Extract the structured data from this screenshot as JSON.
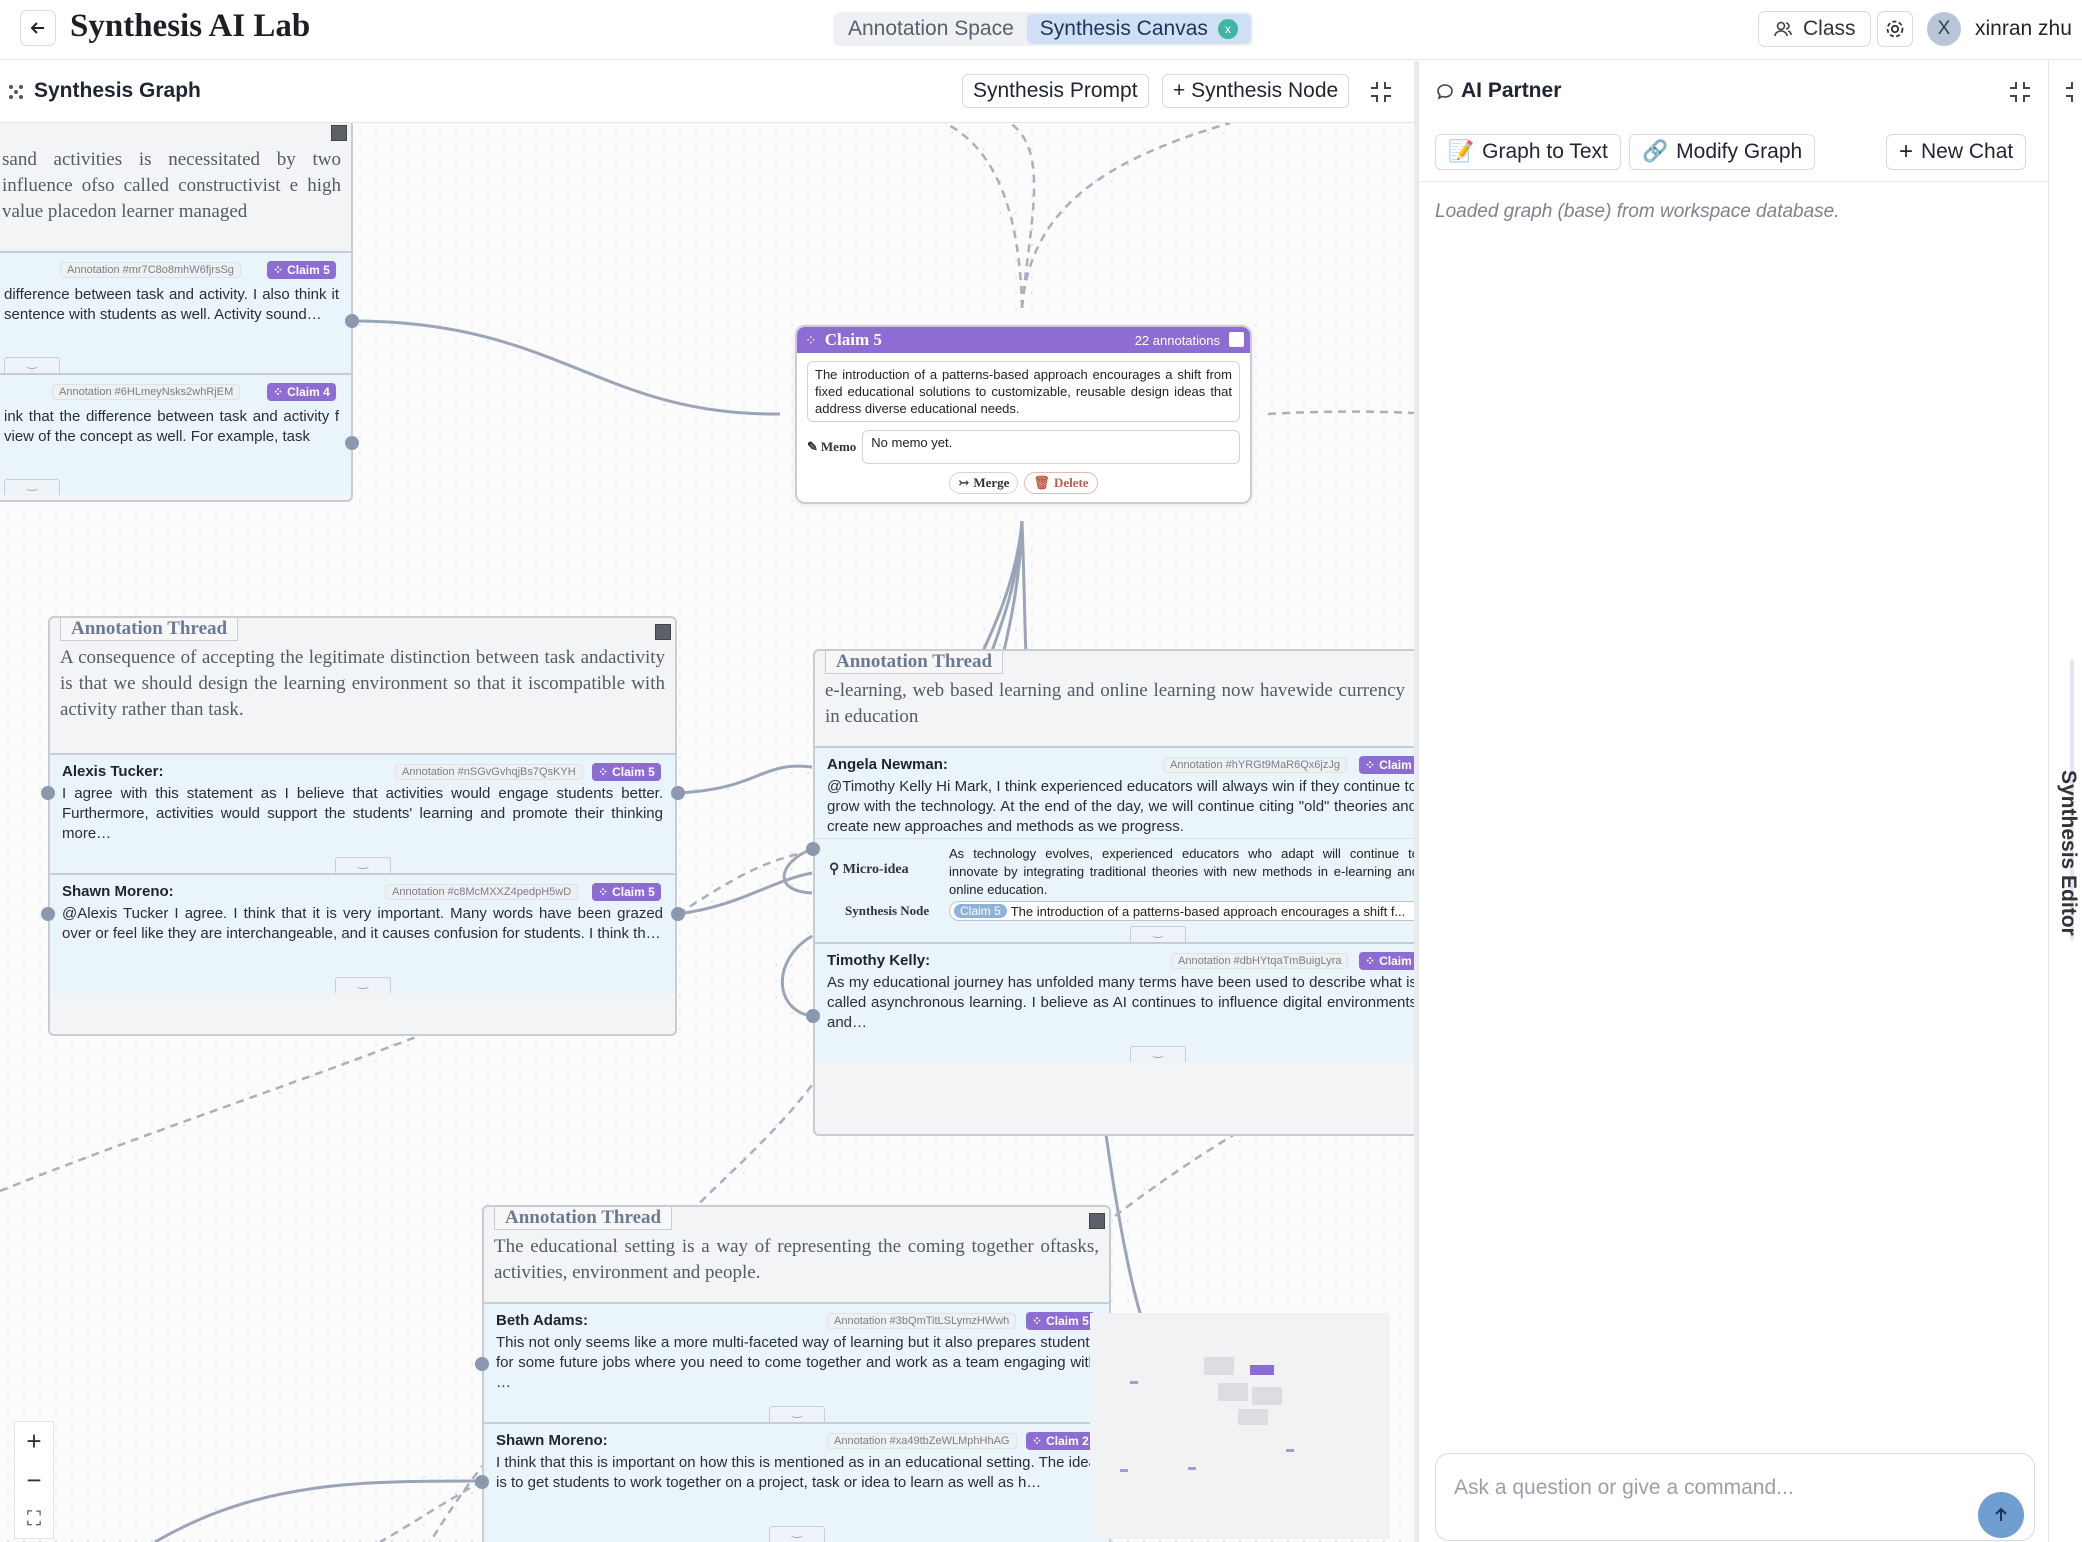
{
  "header": {
    "title": "Synthesis AI Lab",
    "tabs": [
      {
        "label": "Annotation Space"
      },
      {
        "label": "Synthesis Canvas",
        "badge": "x"
      }
    ],
    "class_label": "Class",
    "avatar_initial": "X",
    "user_name": "xinran zhu"
  },
  "graph": {
    "title": "Synthesis Graph",
    "prompt_button": "Synthesis Prompt",
    "node_button": "+ Synthesis Node",
    "zoom_in": "+",
    "zoom_out": "−",
    "fit": "⛶"
  },
  "claim": {
    "title": "Claim 5",
    "count": "22 annotations",
    "text": "The introduction of a patterns-based approach encourages a shift from fixed educational solutions to customizable, reusable design ideas that address diverse educational needs.",
    "memo_label": "Memo",
    "memo": "No memo yet.",
    "merge": "Merge",
    "delete": "Delete"
  },
  "thread_top": {
    "text": "sand activities is necessitated by two influence ofso called constructivist e high value placedon learner managed",
    "annotations": [
      {
        "id": "Annotation #mr7C8o8mhW6fjrsSg",
        "claim": "Claim 5",
        "body": "difference between task and activity. I also think it sentence with students as well. Activity sound…"
      },
      {
        "id": "Annotation #6HLmeyNsks2whRjEM",
        "claim": "Claim 4",
        "body": "ink that the difference between task and activity f view of the concept as well. For example, task"
      }
    ]
  },
  "thread_left": {
    "label": "Annotation Thread",
    "text": "A consequence of accepting the legitimate distinction between task andactivity is that we should design the learning environment so that it iscompatible with activity rather than task.",
    "annotations": [
      {
        "name": "Alexis Tucker:",
        "id": "Annotation #nSGvGvhqjBs7QsKYH",
        "claim": "Claim 5",
        "body": "I agree with this statement as I believe that activities would engage students better. Furthermore, activities would support the students' learning and promote their thinking more…"
      },
      {
        "name": "Shawn Moreno:",
        "id": "Annotation #c8McMXXZ4pedpH5wD",
        "claim": "Claim 5",
        "body": "@Alexis Tucker I agree. I think that it is very important. Many words have been grazed over or feel like they are interchangeable, and it causes confusion for students. I think th…"
      }
    ]
  },
  "thread_right": {
    "label": "Annotation Thread",
    "text": "e-learning, web based learning and online learning now havewide currency in education",
    "annotations": [
      {
        "name": "Angela Newman:",
        "id": "Annotation #hYRGt9MaR6Qx6jzJg",
        "claim": "Claim",
        "body": "@Timothy Kelly Hi Mark, I think experienced educators will always win if they continue to grow with the technology. At the end of the day, we will continue citing \"old\" theories and create new approaches and methods as we progress."
      },
      {
        "name": "Timothy Kelly:",
        "id": "Annotation #dbHYtqaTmBuigLyra",
        "claim": "Claim",
        "body": "As my educational journey has unfolded many terms have been used to describe what is called asynchronous learning. I believe as AI continues to influence digital environments and…"
      }
    ],
    "micro_label": "Micro-idea",
    "micro_text": "As technology evolves, experienced educators who adapt will continue to innovate by integrating traditional theories with new methods in e-learning and online education.",
    "synth_label": "Synthesis Node",
    "synth_tag": "Claim 5",
    "synth_text": "The introduction of a patterns-based approach encourages a shift f..."
  },
  "thread_bottom": {
    "label": "Annotation Thread",
    "text": "The educational setting is a way of representing the coming together oftasks, activities, environment and people.",
    "annotations": [
      {
        "name": "Beth Adams:",
        "id": "Annotation #3bQmTitLSLymzHWwh",
        "claim": "Claim 5",
        "body": "This not only seems like a more multi-faceted way of learning but it also prepares students for some future jobs where you need to come together and work as a team engaging with …"
      },
      {
        "name": "Shawn Moreno:",
        "id": "Annotation #xa49tbZeWLMphHhAG",
        "claim": "Claim 2",
        "body": "I think that this is important on how this is mentioned as in an educational setting. The idea is to get students to work together on a project, task or idea to learn as well as h…"
      }
    ]
  },
  "partner": {
    "title": "AI Partner",
    "graph_to_text": "Graph to Text",
    "modify_graph": "Modify Graph",
    "new_chat": "New Chat",
    "message": "Loaded graph (base) from workspace database.",
    "input_placeholder": "Ask a question or give a command..."
  },
  "side_tab": "Synthesis Editor",
  "colors": {
    "claim": "#8d6cd3",
    "accent_tab": "#cfe0f5",
    "edge": "#8b98ad"
  }
}
